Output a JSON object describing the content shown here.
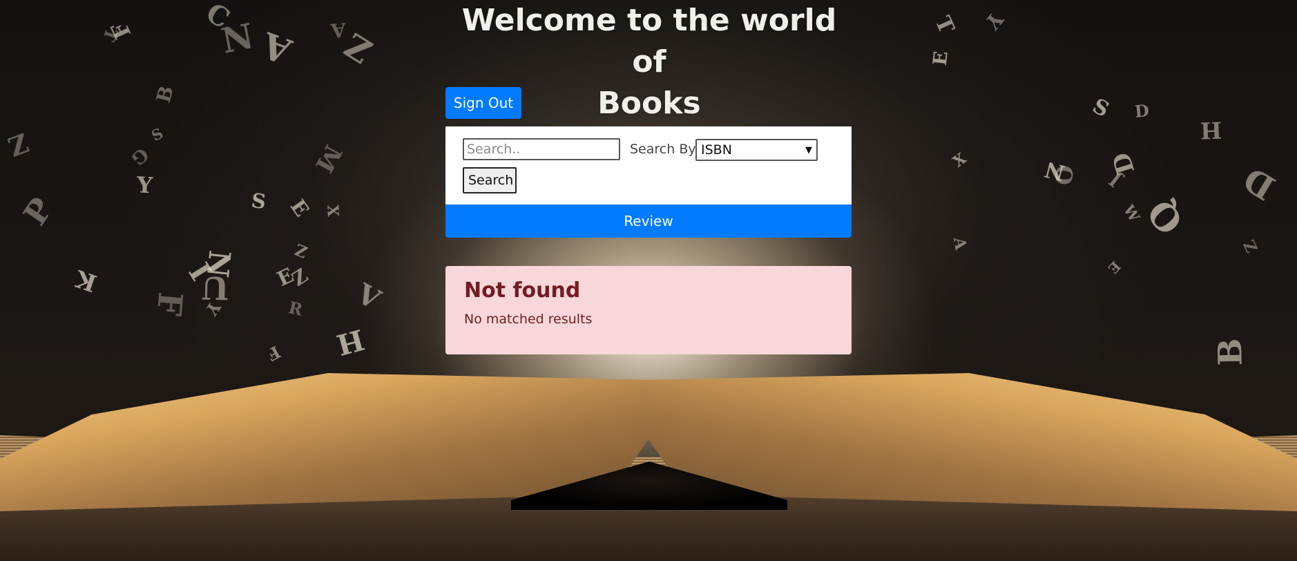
{
  "page": {
    "title_line1": "Welcome to the world of",
    "title_line2": "Books"
  },
  "auth": {
    "signout_label": "Sign Out"
  },
  "search": {
    "placeholder": "Search..",
    "value": "",
    "search_by_label": "Search By:",
    "selected_option": "ISBN",
    "button_label": "Search"
  },
  "review": {
    "label": "Review"
  },
  "alert": {
    "title": "Not found",
    "message": "No matched results"
  },
  "colors": {
    "primary": "#007bff",
    "alert_bg": "#f8d7da",
    "alert_text": "#721c24"
  },
  "background": {
    "letters": [
      "X",
      "Z",
      "V",
      "Z",
      "N",
      "F",
      "D",
      "E",
      "S",
      "J",
      "A",
      "F",
      "H",
      "O",
      "E",
      "B",
      "Y",
      "N",
      "Z",
      "D",
      "F",
      "I",
      "R",
      "P",
      "A",
      "B",
      "C",
      "Y",
      "E",
      "S",
      "T",
      "N",
      "X",
      "H",
      "D",
      "Q",
      "A",
      "U",
      "E",
      "Z",
      "S",
      "T",
      "Z",
      "Y",
      "W",
      "M",
      "K",
      "G"
    ]
  }
}
